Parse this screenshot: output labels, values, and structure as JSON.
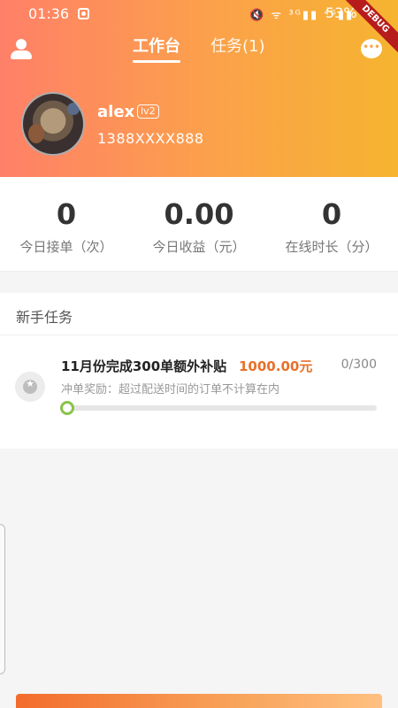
{
  "status_bar": {
    "time": "01:36",
    "icons": "🔇 ᯤ ³ᴳ▮▮ ⁴ᴳ▮▮",
    "battery": "53%"
  },
  "debug_banner": "DEBUG",
  "nav": {
    "tabs": [
      {
        "label": "工作台",
        "active": true
      },
      {
        "label": "任务(1)",
        "active": false
      }
    ],
    "left_icon": "user-icon",
    "right_icon": "chat-icon"
  },
  "profile": {
    "name": "alex",
    "level": "lv2",
    "phone": "1388XXXX888"
  },
  "stats": [
    {
      "value": "0",
      "label": "今日接单（次）"
    },
    {
      "value": "0.00",
      "label": "今日收益（元）"
    },
    {
      "value": "0",
      "label": "在线时长（分）"
    }
  ],
  "newbie_tasks": {
    "title": "新手任务",
    "tasks": [
      {
        "title": "11月份完成300单额外补贴",
        "reward": "1000.00元",
        "progress_text": "0/300",
        "progress_fraction": 0,
        "description": "冲单奖励：超过配送时间的订单不计算在内",
        "icon": "medal-icon"
      }
    ]
  },
  "colors": {
    "header_start": "#ff8068",
    "header_end": "#f6b42f",
    "reward": "#e8702a",
    "progress": "#8bc34a"
  }
}
